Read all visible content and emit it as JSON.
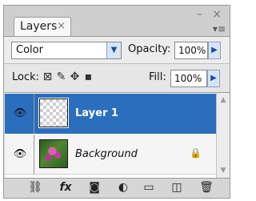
{
  "panel": {
    "tab_label": "Layers",
    "tab_close": "×",
    "window_controls": "– ×",
    "menu_icon": "▾≡"
  },
  "blend": {
    "mode": "Color",
    "opacity_label": "Opacity:",
    "opacity_value": "100%"
  },
  "lock": {
    "label": "Lock:",
    "fill_label": "Fill:",
    "fill_value": "100%"
  },
  "layers": [
    {
      "name": "Layer 1",
      "selected": true,
      "visible": true
    },
    {
      "name": "Background",
      "selected": false,
      "visible": true,
      "locked": true
    }
  ],
  "icons": {
    "eye": "👁",
    "lock": "🔒",
    "link": "⛓",
    "fx": "fx",
    "mask": "◙",
    "adjustment": "◐",
    "folder": "▭",
    "new_layer": "◫",
    "trash": "🗑"
  }
}
